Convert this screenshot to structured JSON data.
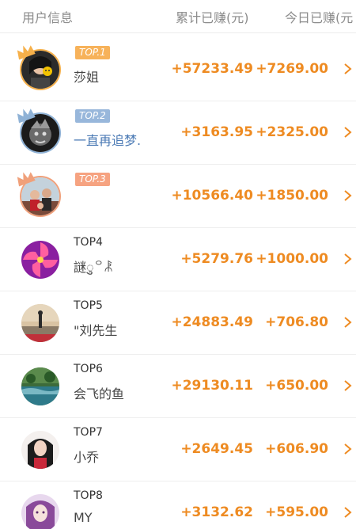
{
  "header": {
    "user_label": "用户信息",
    "total_label": "累计已赚(元)",
    "today_label": "今日已赚(元"
  },
  "colors": {
    "accent": "#ee8b22",
    "gold": "#f7b25a",
    "blue": "#98b7db",
    "bronze": "#f6a381"
  },
  "rows": [
    {
      "rank": "TOP.1",
      "name": "莎姐",
      "total": "+57233.49",
      "today": "+7269.00"
    },
    {
      "rank": "TOP.2",
      "name": "一直再追梦.",
      "total": "+3163.95",
      "today": "+2325.00"
    },
    {
      "rank": "TOP.3",
      "name": "",
      "total": "+10566.40",
      "today": "+1850.00"
    },
    {
      "rank": "TOP4",
      "name": "謎ु꒪ꂿ",
      "total": "+5279.76",
      "today": "+1000.00"
    },
    {
      "rank": "TOP5",
      "name": "\"刘先生",
      "total": "+24883.49",
      "today": "+706.80"
    },
    {
      "rank": "TOP6",
      "name": "会飞的鱼",
      "total": "+29130.11",
      "today": "+650.00"
    },
    {
      "rank": "TOP7",
      "name": "小乔",
      "total": "+2649.45",
      "today": "+606.90"
    },
    {
      "rank": "TOP8",
      "name": "MY",
      "total": "+3132.62",
      "today": "+595.00"
    }
  ]
}
